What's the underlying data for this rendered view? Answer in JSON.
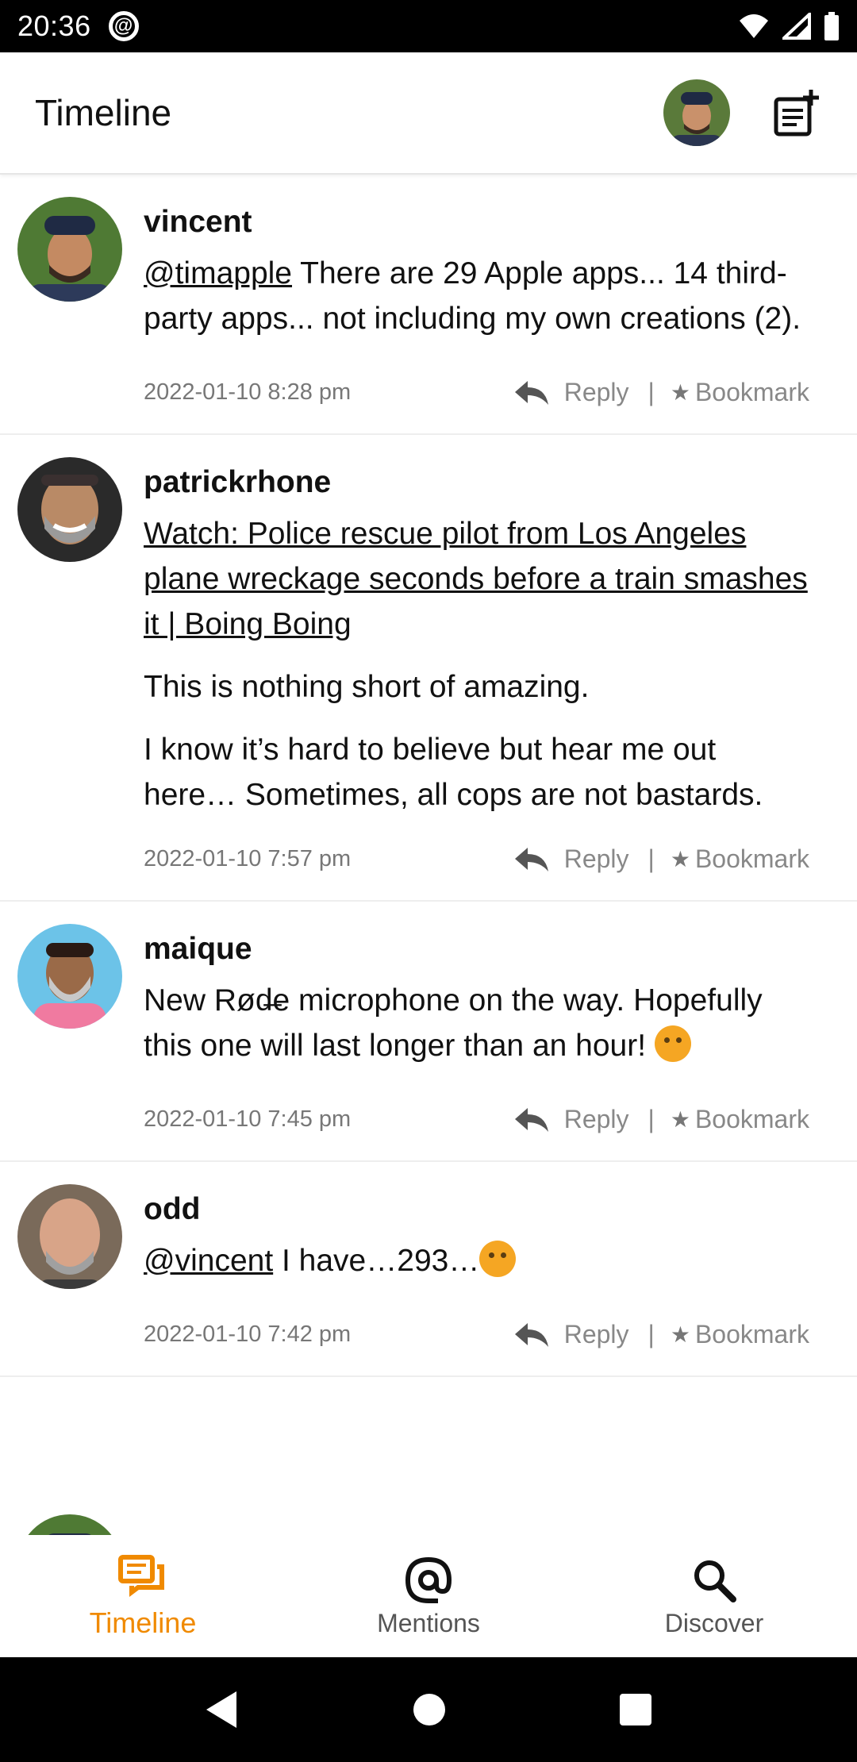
{
  "status_bar": {
    "time": "20:36"
  },
  "app_bar": {
    "title": "Timeline"
  },
  "posts": [
    {
      "username": "vincent",
      "mention": "@timapple",
      "text": " There are 29 Apple apps... 14 third-party apps... not including my own creations (2).",
      "timestamp": "2022-01-10 8:28 pm",
      "reply_label": "Reply",
      "bookmark_label": "Bookmark"
    },
    {
      "username": "patrickrhone",
      "link_text": "Watch: Police rescue pilot from Los Angeles plane wreckage seconds before a train smashes it | Boing Boing",
      "para1": "This is nothing short of amazing.",
      "para2": "I know it’s hard to believe but hear me out here… Sometimes, all cops are not bastards.",
      "timestamp": "2022-01-10 7:57 pm",
      "reply_label": "Reply",
      "bookmark_label": "Bookmark"
    },
    {
      "username": "maique",
      "text": "New Rød̶e microphone on the way. Hopefully this one will last longer than an hour!",
      "emoji": "weary-face-emoji",
      "timestamp": "2022-01-10 7:45 pm",
      "reply_label": "Reply",
      "bookmark_label": "Bookmark"
    },
    {
      "username": "odd",
      "mention": "@vincent",
      "text": " I have…293…",
      "emoji": "crying-face-emoji",
      "timestamp": "2022-01-10 7:42 pm",
      "reply_label": "Reply",
      "bookmark_label": "Bookmark"
    }
  ],
  "bottom_nav": {
    "items": [
      {
        "label": "Timeline",
        "icon": "timeline-icon",
        "active": true
      },
      {
        "label": "Mentions",
        "icon": "at-icon",
        "active": false
      },
      {
        "label": "Discover",
        "icon": "search-icon",
        "active": false
      }
    ]
  },
  "colors": {
    "accent": "#f08a00",
    "text": "#111111",
    "muted": "#777777"
  }
}
